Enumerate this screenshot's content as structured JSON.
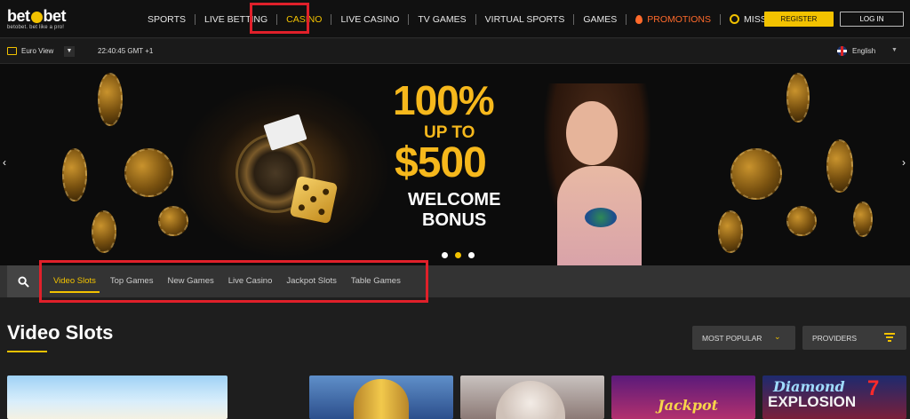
{
  "brand": {
    "name_left": "bet",
    "name_right": "bet",
    "tagline": "betobet. bet like a pro!"
  },
  "nav": {
    "items": [
      {
        "label": "SPORTS"
      },
      {
        "label": "LIVE BETTING"
      },
      {
        "label": "CASINO"
      },
      {
        "label": "LIVE CASINO"
      },
      {
        "label": "TV GAMES"
      },
      {
        "label": "VIRTUAL SPORTS"
      },
      {
        "label": "GAMES"
      },
      {
        "label": "PROMOTIONS"
      },
      {
        "label": "MISSIONS"
      }
    ],
    "active": "CASINO",
    "register_label": "REGISTER",
    "login_label": "LOG IN"
  },
  "subbar": {
    "view_label": "Euro View",
    "time": "22:40:45 GMT +1",
    "language": "English"
  },
  "banner": {
    "headline": "100%",
    "line2": "UP TO",
    "amount": "$500",
    "line4": "WELCOME",
    "line5": "BONUS",
    "slide_count": 3,
    "active_slide": 2
  },
  "categories": {
    "tabs": [
      {
        "label": "Video Slots"
      },
      {
        "label": "Top Games"
      },
      {
        "label": "New Games"
      },
      {
        "label": "Live Casino"
      },
      {
        "label": "Jackpot Slots"
      },
      {
        "label": "Table Games"
      }
    ],
    "active": "Video Slots"
  },
  "section": {
    "title": "Video Slots",
    "sort_label": "MOST POPULAR",
    "providers_label": "PROVIDERS"
  },
  "games": {
    "tile4_text": "Jackpot",
    "tile5_text_top": "Diamond",
    "tile5_text_bottom": "EXPLOSION",
    "tile5_badge": "7"
  },
  "colors": {
    "accent": "#f2c200",
    "promo": "#ff6a2b",
    "highlight_box": "#e0202a",
    "background": "#1e1e1e"
  }
}
